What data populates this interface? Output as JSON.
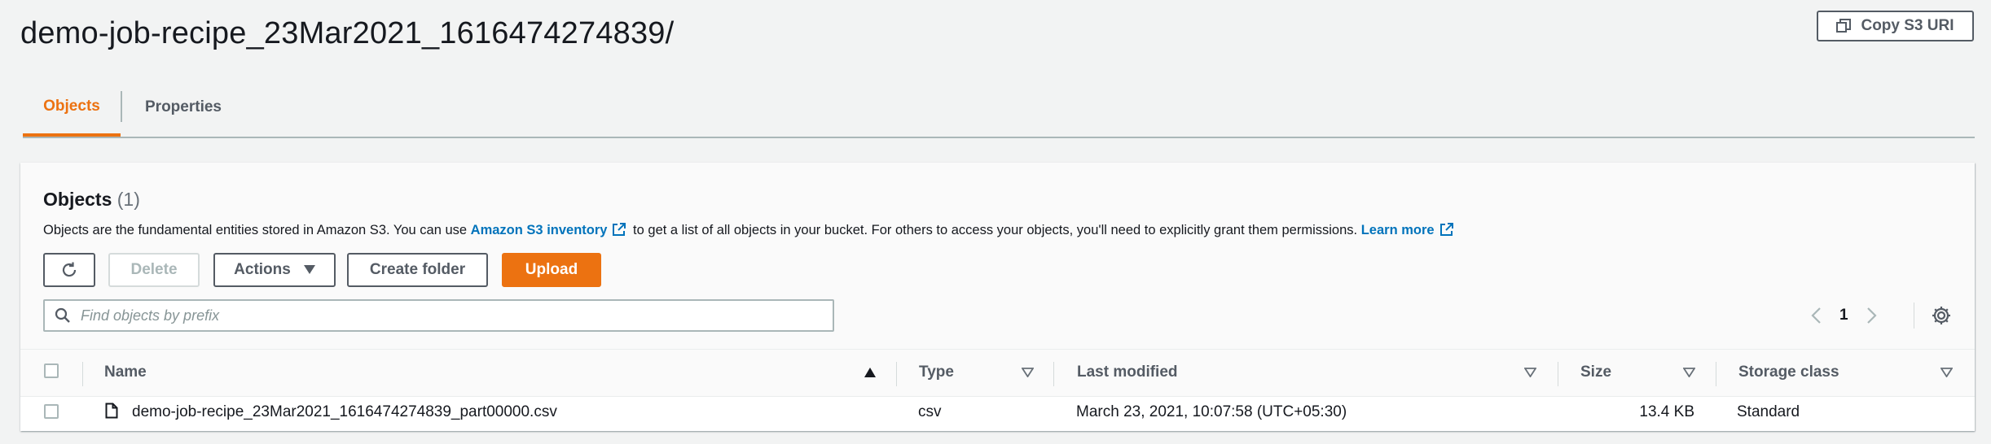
{
  "header": {
    "title": "demo-job-recipe_23Mar2021_1616474274839/",
    "copy_uri_label": "Copy S3 URI"
  },
  "tabs": [
    {
      "label": "Objects",
      "active": true
    },
    {
      "label": "Properties",
      "active": false
    }
  ],
  "objects_panel": {
    "title": "Objects",
    "count": "(1)",
    "description": {
      "part1": "Objects are the fundamental entities stored in Amazon S3. You can use ",
      "link1": "Amazon S3 inventory",
      "part2": " to get a list of all objects in your bucket. For others to access your objects, you'll need to explicitly grant them permissions. ",
      "link2": "Learn more"
    },
    "buttons": {
      "refresh_icon": "refresh-icon",
      "delete": "Delete",
      "actions": "Actions",
      "create_folder": "Create folder",
      "upload": "Upload"
    },
    "search": {
      "placeholder": "Find objects by prefix",
      "value": ""
    },
    "pagination": {
      "current_page": "1"
    }
  },
  "table": {
    "columns": [
      {
        "key": "name",
        "label": "Name",
        "sort": "ascending"
      },
      {
        "key": "type",
        "label": "Type",
        "sort": "none"
      },
      {
        "key": "last_modified",
        "label": "Last modified",
        "sort": "none"
      },
      {
        "key": "size",
        "label": "Size",
        "sort": "none"
      },
      {
        "key": "storage_class",
        "label": "Storage class",
        "sort": "none"
      }
    ],
    "rows": [
      {
        "name": "demo-job-recipe_23Mar2021_1616474274839_part00000.csv",
        "type": "csv",
        "last_modified": "March 23, 2021, 10:07:58 (UTC+05:30)",
        "size": "13.4 KB",
        "storage_class": "Standard",
        "selected": false
      }
    ]
  },
  "colors": {
    "accent": "#ec7211",
    "link": "#0073bb",
    "background": "#f2f3f3"
  }
}
